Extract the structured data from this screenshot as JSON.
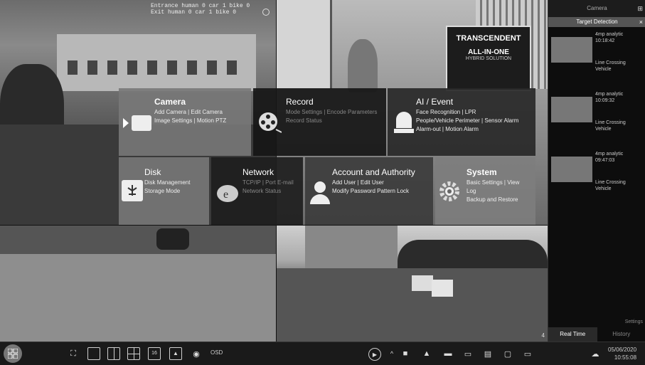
{
  "overlay_top": {
    "line1": "Entrance  human 0 car 1 bike 0",
    "line2": "Exit      human 0 car 1 bike 0"
  },
  "menu": {
    "camera": {
      "title": "Camera",
      "links": [
        "Add Camera | Edit Camera",
        "Image Settings | Motion  PTZ"
      ],
      "icon": "camera-icon"
    },
    "record": {
      "title": "Record",
      "links": [
        "Mode Settings | Encode Parameters",
        "Record Status"
      ],
      "icon": "film-reel-icon"
    },
    "ai": {
      "title": "AI / Event",
      "links": [
        "Face Recognition | LPR",
        "People/Vehicle Perimeter | Sensor Alarm",
        "Alarm-out | Motion Alarm"
      ],
      "icon": "alarm-light-icon"
    },
    "disk": {
      "title": "Disk",
      "links": [
        "Disk Management",
        "Storage Mode"
      ],
      "icon": "disk-icon"
    },
    "network": {
      "title": "Network",
      "links": [
        "TCP/IP | Port  E-mail",
        "Network Status"
      ],
      "icon": "network-icon"
    },
    "account": {
      "title": "Account and Authority",
      "links": [
        "Add User | Edit User",
        "Modify Password  Pattern Lock"
      ],
      "icon": "user-icon"
    },
    "system": {
      "title": "System",
      "links": [
        "Basic Settings | View Log",
        "Backup and Restore"
      ],
      "icon": "gear-icon"
    }
  },
  "panel": {
    "header": "Camera",
    "subheader": "Target Detection",
    "events": [
      {
        "name": "4mp analytic",
        "time": "10:18:42",
        "type": "Line Crossing",
        "target": "Vehicle"
      },
      {
        "name": "4mp analytic",
        "time": "10:09:32",
        "type": "Line Crossing",
        "target": "Vehicle"
      },
      {
        "name": "4mp analytic",
        "time": "09:47:03",
        "type": "Line Crossing",
        "target": "Vehicle"
      }
    ],
    "settings": "Settings",
    "tab_realtime": "Real Time",
    "tab_history": "History"
  },
  "toolbar": {
    "osd": "OSD",
    "date": "05/06/2020",
    "time": "10:55:08",
    "tile_count": "16",
    "feed_number": "4"
  },
  "sign": {
    "brand": "TRANSCENDENT",
    "sub": "ALL-IN-ONE",
    "sub2": "HYBRID SOLUTION"
  }
}
